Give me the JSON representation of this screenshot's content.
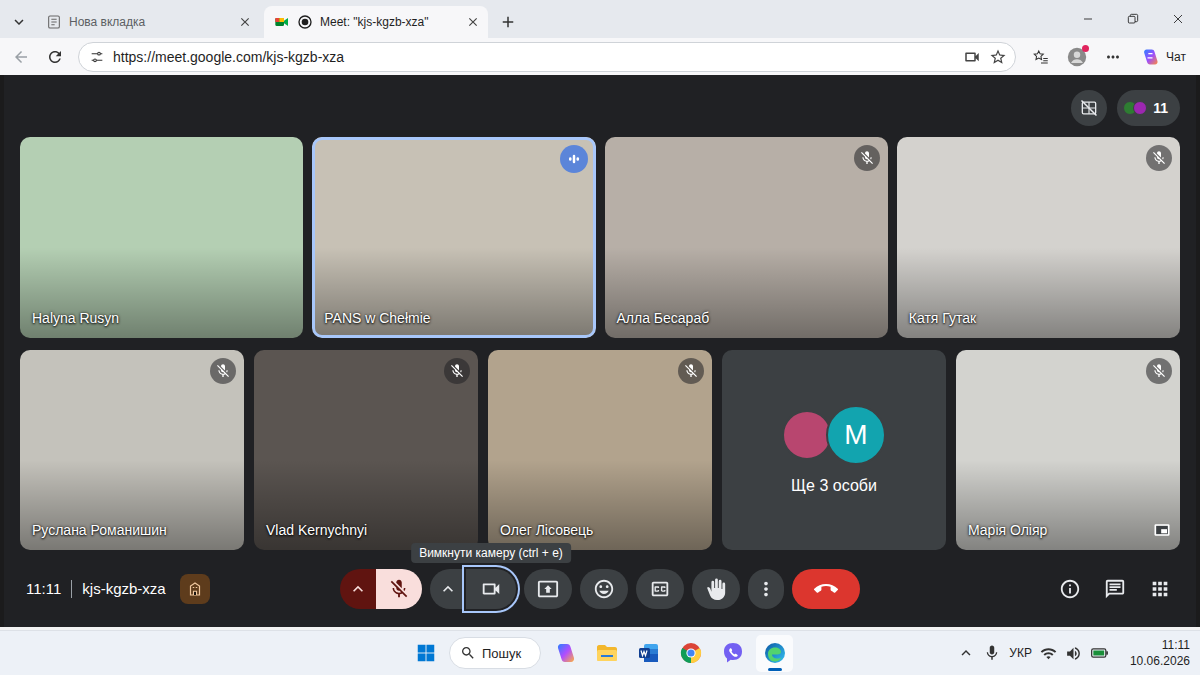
{
  "browser": {
    "tabs": [
      {
        "label": "Нова вкладка",
        "selected": false,
        "kind": "newtab"
      },
      {
        "label": "Meet: \"kjs-kgzb-xza\"",
        "selected": true,
        "kind": "meet"
      }
    ],
    "url": "https://meet.google.com/kjs-kgzb-xza",
    "copilot_label": "Чат",
    "profile_notification": true
  },
  "meet": {
    "participant_count": "11",
    "tiles": [
      {
        "name": "Halyna Rusyn",
        "kind": "video",
        "muted": false,
        "speaking": false,
        "self_view": false,
        "color": "#b4cfb3"
      },
      {
        "name": "PANS w Chełmie",
        "kind": "video",
        "muted": false,
        "speaking": true,
        "self_view": false,
        "color": "#c7c1b5"
      },
      {
        "name": "Алла Бесараб",
        "kind": "video",
        "muted": true,
        "speaking": false,
        "self_view": false,
        "color": "#b7afa7"
      },
      {
        "name": "Катя Гутак",
        "kind": "video",
        "muted": true,
        "speaking": false,
        "self_view": false,
        "color": "#d4d2ce"
      },
      {
        "name": "Руслана Романишин",
        "kind": "video",
        "muted": true,
        "speaking": false,
        "self_view": false,
        "color": "#c4c2bb"
      },
      {
        "name": "Vlad Kernychnyi",
        "kind": "video",
        "muted": true,
        "speaking": false,
        "self_view": false,
        "color": "#5b5551"
      },
      {
        "name": "Олег Лісовець",
        "kind": "video",
        "muted": true,
        "speaking": false,
        "self_view": false,
        "color": "#b2a38d"
      },
      {
        "label": "Ще 3 особи",
        "kind": "overflow",
        "avatar_letter": "M",
        "avatar_color": "#12a4af",
        "photo_color": "#b8466f",
        "muted": false,
        "speaking": false,
        "self_view": false,
        "color": "#3c4043"
      },
      {
        "name": "Марія Оліяр",
        "kind": "video",
        "muted": true,
        "speaking": false,
        "self_view": true,
        "color": "#d3d3cf"
      }
    ],
    "clock": "11:11",
    "meeting_code": "kjs-kgzb-xza",
    "mic_on": false,
    "camera_on": true,
    "tooltip": "Вимкнути камеру (ctrl + e)"
  },
  "taskbar": {
    "search": "Пошук",
    "apps": [
      {
        "kind": "copilot",
        "active": false
      },
      {
        "kind": "explorer",
        "active": false
      },
      {
        "kind": "word",
        "active": false
      },
      {
        "kind": "chrome",
        "active": false
      },
      {
        "kind": "viber",
        "active": false
      },
      {
        "kind": "edge",
        "active": true
      }
    ],
    "language": "УКР",
    "time": "11:11",
    "date": "10.06.2026"
  }
}
